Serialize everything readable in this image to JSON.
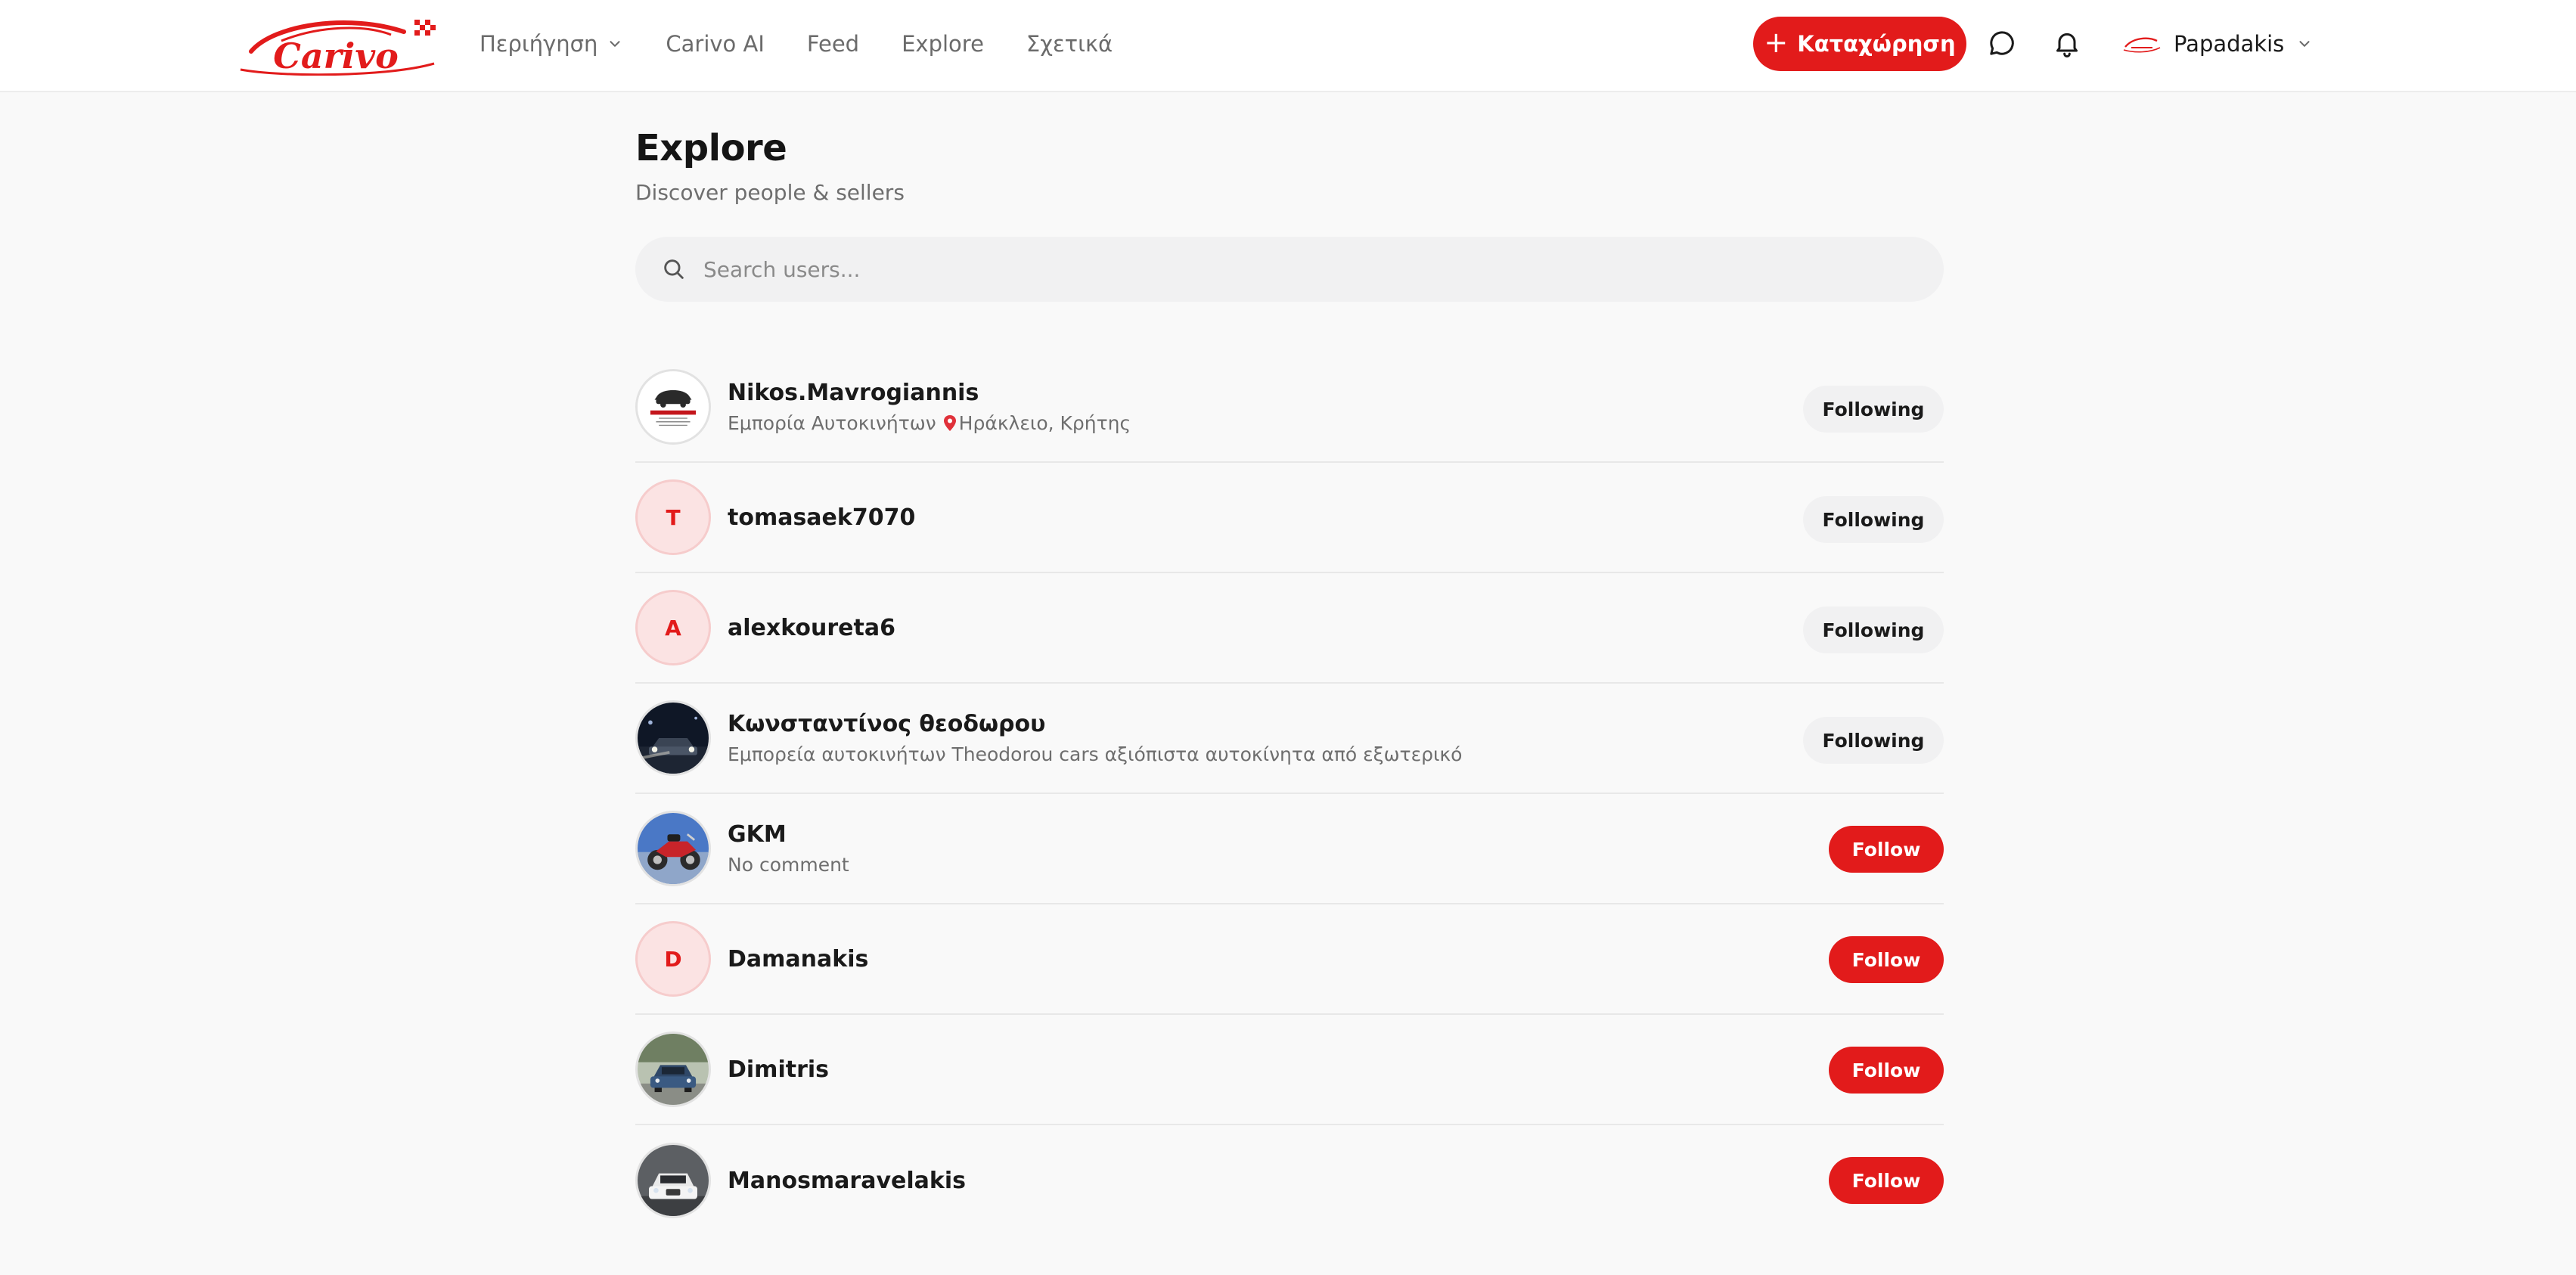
{
  "brand": {
    "name": "Carivo",
    "accent": "#e21b1b"
  },
  "nav": {
    "items": [
      {
        "label": "Περιήγηση",
        "dropdown": true
      },
      {
        "label": "Carivo AI"
      },
      {
        "label": "Feed"
      },
      {
        "label": "Explore"
      },
      {
        "label": "Σχετικά"
      }
    ],
    "cta_label": "Καταχώρηση",
    "cta_icon": "plus-icon",
    "icons": [
      "chat-icon",
      "bell-icon"
    ],
    "user_name": "Papadakis"
  },
  "page": {
    "title": "Explore",
    "subtitle": "Discover people & sellers"
  },
  "search": {
    "placeholder": "Search users..."
  },
  "users": [
    {
      "name": "Nikos.Mavrogiannis",
      "bio": "Εμπορία Αυτοκινήτων",
      "location": "Ηράκλειο, Κρήτης",
      "avatar": "logo",
      "status": "Following"
    },
    {
      "name": "tomasaek7070",
      "avatar_letter": "T",
      "status": "Following"
    },
    {
      "name": "alexkoureta6",
      "avatar_letter": "A",
      "status": "Following"
    },
    {
      "name": "Κωνσταντίνος θεοδωρου",
      "bio": "Εμπορεία αυτοκινήτων Theodorou cars αξιόπιστα αυτοκίνητα από εξωτερικό",
      "avatar": "photo-night-car",
      "status": "Following"
    },
    {
      "name": "GKM",
      "bio": "No comment",
      "avatar": "photo-motorcycle",
      "status": "Follow"
    },
    {
      "name": "Damanakis",
      "avatar_letter": "D",
      "status": "Follow"
    },
    {
      "name": "Dimitris",
      "avatar": "photo-blue-car",
      "status": "Follow"
    },
    {
      "name": "Manosmaravelakis",
      "avatar": "photo-white-car",
      "status": "Follow"
    }
  ]
}
